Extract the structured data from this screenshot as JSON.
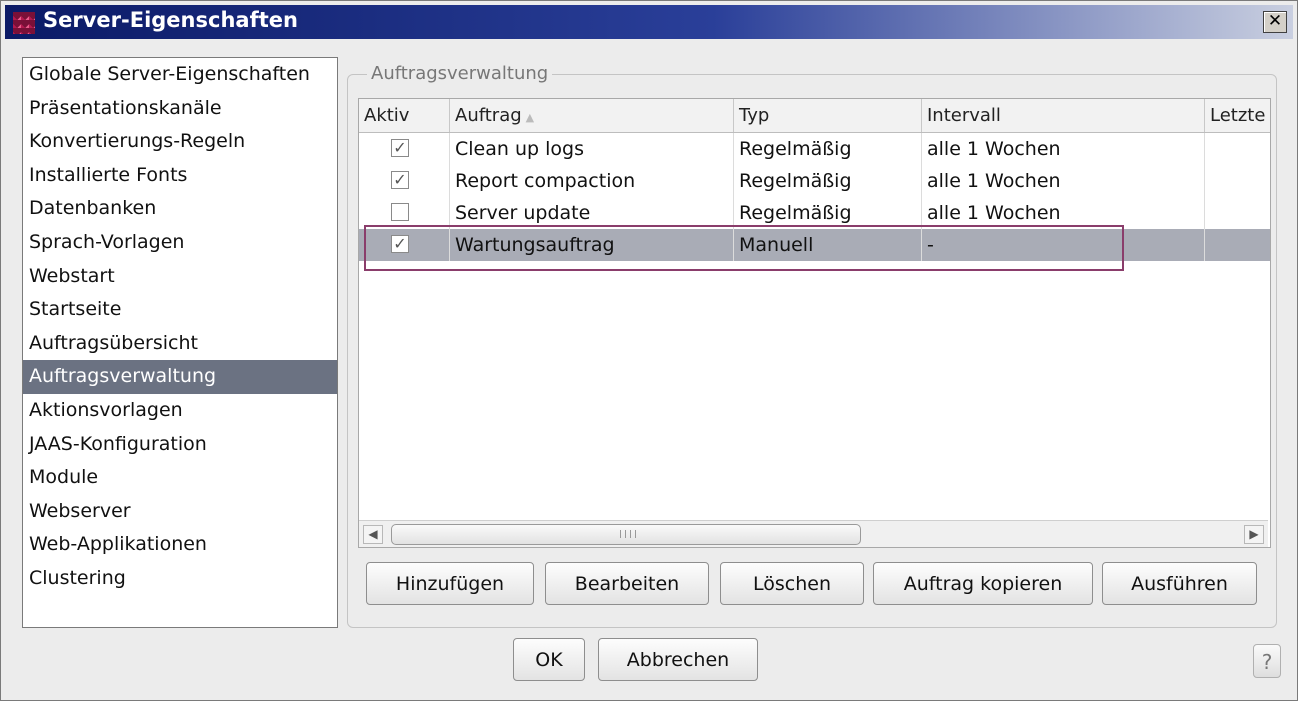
{
  "window": {
    "title": "Server-Eigenschaften",
    "close_label": "✕"
  },
  "sidebar": {
    "items": [
      {
        "label": "Globale Server-Eigenschaften"
      },
      {
        "label": "Präsentationskanäle"
      },
      {
        "label": "Konvertierungs-Regeln"
      },
      {
        "label": "Installierte Fonts"
      },
      {
        "label": "Datenbanken"
      },
      {
        "label": "Sprach-Vorlagen"
      },
      {
        "label": "Webstart"
      },
      {
        "label": "Startseite"
      },
      {
        "label": "Auftragsübersicht"
      },
      {
        "label": "Auftragsverwaltung",
        "selected": true
      },
      {
        "label": "Aktionsvorlagen"
      },
      {
        "label": "JAAS-Konfiguration"
      },
      {
        "label": "Module"
      },
      {
        "label": "Webserver"
      },
      {
        "label": "Web-Applikationen"
      },
      {
        "label": "Clustering"
      }
    ]
  },
  "panel": {
    "title": "Auftragsverwaltung",
    "columns": [
      "Aktiv",
      "Auftrag",
      "Typ",
      "Intervall",
      "Letzte"
    ],
    "sort_indicator": "▲",
    "rows": [
      {
        "active": true,
        "job": "Clean up logs",
        "type": "Regelmäßig",
        "interval": "alle 1 Wochen",
        "last": ""
      },
      {
        "active": true,
        "job": "Report compaction",
        "type": "Regelmäßig",
        "interval": "alle 1 Wochen",
        "last": ""
      },
      {
        "active": false,
        "job": "Server update",
        "type": "Regelmäßig",
        "interval": "alle 1 Wochen",
        "last": ""
      },
      {
        "active": true,
        "job": "Wartungsauftrag",
        "type": "Manuell",
        "interval": "-",
        "last": "",
        "selected": true
      }
    ],
    "buttons": {
      "add": "Hinzufügen",
      "edit": "Bearbeiten",
      "delete": "Löschen",
      "copy": "Auftrag kopieren",
      "run": "Ausführen"
    }
  },
  "footer": {
    "ok": "OK",
    "cancel": "Abbrechen",
    "help": "?"
  },
  "check_glyph": "✓",
  "colors": {
    "title_bar": "#0b1a66",
    "selected_nav": "#6b7282",
    "selected_row": "#a9acb6",
    "highlight_border": "#8a3d6b"
  }
}
